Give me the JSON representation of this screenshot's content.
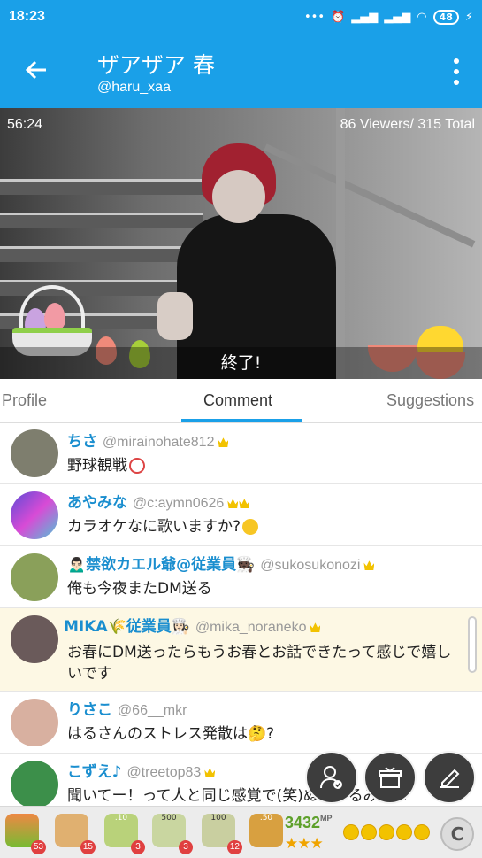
{
  "status": {
    "time": "18:23",
    "battery": "48",
    "icons": [
      "more-icon",
      "alarm-icon",
      "signal-icon",
      "signal-icon",
      "wifi-icon",
      "battery-icon",
      "charging-icon"
    ]
  },
  "appbar": {
    "title": "ザアザア 春",
    "subtitle": "@haru_xaa"
  },
  "video": {
    "elapsed": "56:24",
    "viewers": "86 Viewers/ 315 Total",
    "ended_label": "終了!"
  },
  "tabs": {
    "profile": "Profile",
    "comment": "Comment",
    "suggestions": "Suggestions"
  },
  "comments": [
    {
      "name": "ちさ",
      "handle": "@mirainohate812",
      "message": "野球観戦",
      "emoji": "baseball-icon",
      "badges": 1
    },
    {
      "name": "あやみな",
      "handle": "@c:aymn0626",
      "message": "カラオケなに歌いますか?",
      "emoji": "face-icon",
      "badges": 2
    },
    {
      "name": "🙍🏻‍♂️禁欲カエル爺@従業員🧑🏿‍🍳",
      "handle": "@sukosukonozi",
      "message": "俺も今夜またDM送る",
      "badges": 1
    },
    {
      "name": "MIKA🌾従業員👩🏻‍🍳",
      "handle": "@mika_noraneko",
      "message": "お春にDM送ったらもうお春とお話できたって感じで嬉しいです",
      "badges": 1,
      "highlight": true
    },
    {
      "name": "りさこ",
      "handle": "@66__mkr",
      "message": "はるさんのストレス発散は🤔?",
      "badges": 0
    },
    {
      "name": "こずえ♪",
      "handle": "@treetop83",
      "message": "聞いてー！って人と同じ感覚で(笑)ぬいぐるみに...",
      "badges": 1
    }
  ],
  "bottom": {
    "items": [
      {
        "name": "vegetable-basket-icon",
        "count": "53"
      },
      {
        "name": "bread-icon",
        "count": "15"
      },
      {
        "name": "tea-10-icon",
        "label": ".10",
        "count": "3"
      },
      {
        "name": "tea-500-icon",
        "label": "500",
        "count": "3"
      },
      {
        "name": "tea-100-icon",
        "label": "100",
        "count": "12"
      },
      {
        "name": "tea-50-icon",
        "label": ".50",
        "count": ""
      }
    ],
    "mp": "3432",
    "mp_unit": "MP",
    "stars": "★★★",
    "coins": 5,
    "c_button": "C"
  },
  "colors": {
    "accent": "#1aa0e8",
    "name": "#1a8ecf"
  }
}
